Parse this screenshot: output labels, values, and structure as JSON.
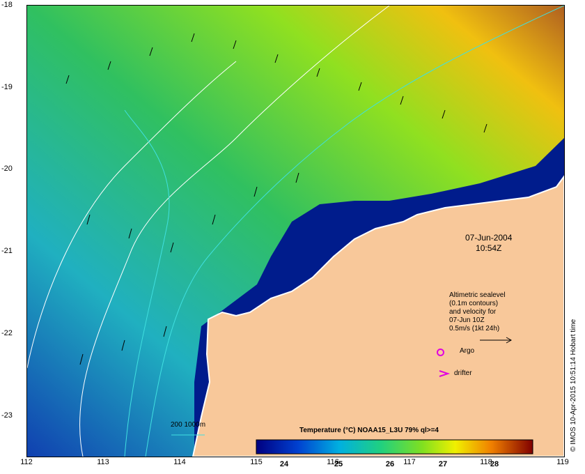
{
  "map": {
    "x_ticks": [
      "112",
      "113",
      "114",
      "115",
      "116",
      "117",
      "118",
      "119"
    ],
    "y_ticks": [
      "-18",
      "-19",
      "-20",
      "-21",
      "-22",
      "-23"
    ],
    "date": "07-Jun-2004",
    "time": "10:54Z"
  },
  "legend": {
    "sealevel_lines": [
      "Altimetric sealevel",
      "(0.1m contours)",
      "and velocity for",
      "07-Jun 10Z",
      "0.5m/s (1kt 24h)"
    ],
    "argo_label": "Argo",
    "drifter_label": "drifter",
    "isobath_label": "200  1000m"
  },
  "colorbar": {
    "title": "Temperature (°C) NOAA15_L3U 79% ql>=4",
    "ticks": [
      "24",
      "25",
      "26",
      "27",
      "28"
    ]
  },
  "credit": "© IMOS 10-Apr-2015 10:51:14 Hobart time",
  "colors": {
    "land": "#f8c89a",
    "argo": "#e000e0",
    "drifter": "#e000e0",
    "isobath": "#40e0e0"
  }
}
